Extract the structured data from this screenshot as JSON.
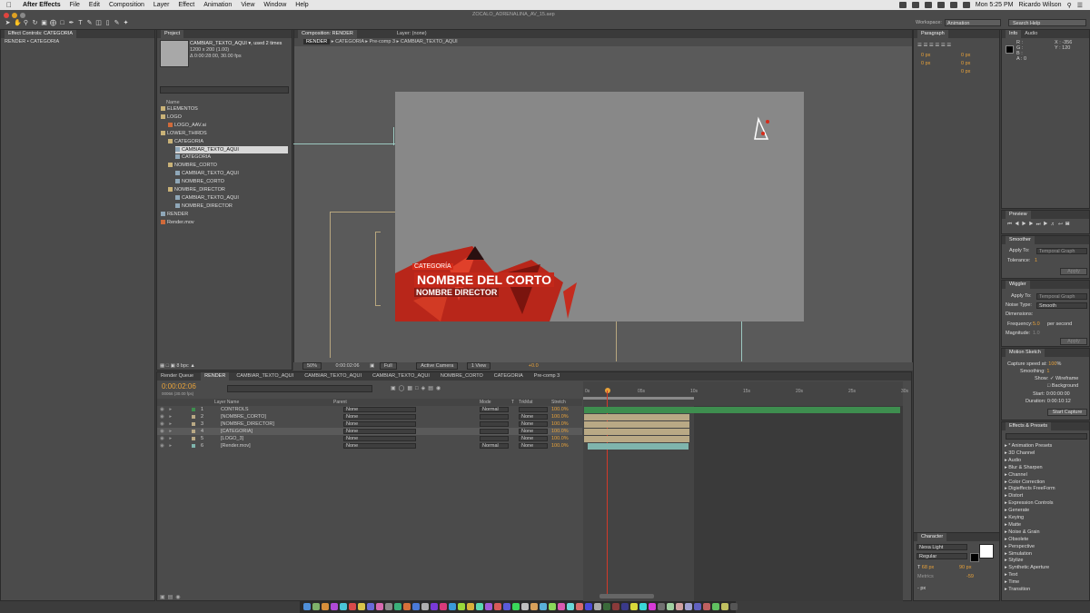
{
  "menubar": {
    "app": "After Effects",
    "items": [
      "File",
      "Edit",
      "Composition",
      "Layer",
      "Effect",
      "Animation",
      "View",
      "Window",
      "Help"
    ],
    "clock": "Mon 5:25 PM",
    "user": "Ricardo Wilson"
  },
  "window": {
    "title": "ZOCALO_ADRENALINA_AV_15.aep"
  },
  "workspace": {
    "label": "Workspace:",
    "value": "Animation",
    "search_placeholder": "Search Help"
  },
  "effect_controls": {
    "tab": "Effect Controls: CATEGORIA",
    "path": "RENDER • CATEGORIA"
  },
  "project": {
    "tab": "Project",
    "selected_name": "CAMBIAR_TEXTO_AQUI",
    "used": ", used 2 times",
    "dims": "1200 x 200 (1.00)",
    "duration": "Δ 0:00:28:00, 30.00 fps",
    "col_name": "Name",
    "bpc": "8 bpc",
    "items": [
      {
        "label": "ELEMENTOS",
        "indent": 0,
        "type": "folder"
      },
      {
        "label": "LOGO",
        "indent": 0,
        "type": "folder"
      },
      {
        "label": "LOGO_AAV.ai",
        "indent": 1,
        "type": "file"
      },
      {
        "label": "LOWER_THIRDS",
        "indent": 0,
        "type": "folder"
      },
      {
        "label": "CATEGORIA",
        "indent": 1,
        "type": "folder"
      },
      {
        "label": "CAMBIAR_TEXTO_AQUI",
        "indent": 2,
        "type": "comp",
        "selected": true
      },
      {
        "label": "CATEGORIA",
        "indent": 2,
        "type": "comp"
      },
      {
        "label": "NOMBRE_CORTO",
        "indent": 1,
        "type": "folder"
      },
      {
        "label": "CAMBIAR_TEXTO_AQUI",
        "indent": 2,
        "type": "comp"
      },
      {
        "label": "NOMBRE_CORTO",
        "indent": 2,
        "type": "comp"
      },
      {
        "label": "NOMBRE_DIRECTOR",
        "indent": 1,
        "type": "folder"
      },
      {
        "label": "CAMBIAR_TEXTO_AQUI",
        "indent": 2,
        "type": "comp"
      },
      {
        "label": "NOMBRE_DIRECTOR",
        "indent": 2,
        "type": "comp"
      },
      {
        "label": "RENDER",
        "indent": 0,
        "type": "comp"
      },
      {
        "label": "Render.mov",
        "indent": 0,
        "type": "file"
      }
    ]
  },
  "composition": {
    "tab": "Composition: RENDER",
    "layer_tab": "Layer: (none)",
    "breadcrumbs": [
      "RENDER",
      "CATEGORIA",
      "Pre-comp 3",
      "CAMBIAR_TEXTO_AQUI"
    ],
    "zoom": "50%",
    "timecode": "0:00:02:06",
    "resolution": "Full",
    "camera": "Active Camera",
    "view": "1 View",
    "exposure": "+0.0",
    "lower_third": {
      "category": "CATEGORÍA",
      "name": "NOMBRE DEL CORTO",
      "director": "NOMBRE DIRECTOR"
    }
  },
  "paragraph": {
    "tab": "Paragraph",
    "fields": [
      "0 px",
      "0 px",
      "0 px",
      "0 px",
      "0 px"
    ]
  },
  "info": {
    "tabs": [
      "Info",
      "Audio"
    ],
    "r": "R :",
    "g": "G :",
    "b": "B :",
    "a": "A : 0",
    "x": "X : -356",
    "y": "Y : 120"
  },
  "preview": {
    "tab": "Preview"
  },
  "smoother": {
    "tab": "Smoother",
    "apply_to_label": "Apply To:",
    "apply_to_value": "Temporal Graph",
    "tolerance_label": "Tolerance:",
    "tolerance_value": "1",
    "apply": "Apply"
  },
  "wiggler": {
    "tab": "Wiggler",
    "apply_to_label": "Apply To:",
    "apply_to_value": "Temporal Graph",
    "noise_label": "Noise Type:",
    "noise_value": "Smooth",
    "dimensions_label": "Dimensions:",
    "frequency_label": "Frequency:",
    "frequency_value": "5.0",
    "frequency_unit": "per second",
    "magnitude_label": "Magnitude:",
    "magnitude_value": "1.0",
    "apply": "Apply"
  },
  "motion_sketch": {
    "tab": "Motion Sketch",
    "capture_label": "Capture speed at:",
    "capture_value": "100",
    "capture_unit": "%",
    "smoothing_label": "Smoothing:",
    "smoothing_value": "1",
    "show_label": "Show:",
    "wireframe": "Wireframe",
    "background": "Background",
    "start_label": "Start:",
    "start_value": "0:00:00:00",
    "duration_label": "Duration:",
    "duration_value": "0:00:10:12",
    "button": "Start Capture"
  },
  "effects_presets": {
    "tab": "Effects & Presets",
    "items": [
      "* Animation Presets",
      "3D Channel",
      "Audio",
      "Blur & Sharpen",
      "Channel",
      "Color Correction",
      "Digieffects FreeForm",
      "Distort",
      "Expression Controls",
      "Generate",
      "Keying",
      "Matte",
      "Noise & Grain",
      "Obsolete",
      "Perspective",
      "Simulation",
      "Stylize",
      "Synthetic Aperture",
      "Text",
      "Time",
      "Transition"
    ]
  },
  "character": {
    "tab": "Character",
    "font": "Nexa Light",
    "style": "Regular",
    "size": "68 px",
    "leading": "90 px",
    "kerning": "Metrics",
    "tracking": "-59",
    "baseline": "- px"
  },
  "timeline": {
    "tabs": [
      "Render Queue",
      "RENDER",
      "CAMBIAR_TEXTO_AQUI",
      "CAMBIAR_TEXTO_AQUI",
      "CAMBIAR_TEXTO_AQUI",
      "NOMBRE_CORTO",
      "CATEGORIA",
      "Pre-comp 3"
    ],
    "timecode": "0:00:02:06",
    "frame": "00066 (30.00 fps)",
    "col_layer": "Layer Name",
    "col_parent": "Parent",
    "col_mode": "Mode",
    "col_t": "T",
    "col_trkmat": "TrkMat",
    "col_stretch": "Stretch",
    "ruler": [
      "0s",
      "05s",
      "10s",
      "15s",
      "20s",
      "25s",
      "30s"
    ],
    "layers": [
      {
        "num": "1",
        "name": "CONTROLS",
        "parent": "None",
        "mode": "Normal",
        "trkmat": "",
        "stretch": "100.0%",
        "color": "#3e8e4f"
      },
      {
        "num": "2",
        "name": "[NOMBRE_CORTO]",
        "parent": "None",
        "mode": "",
        "trkmat": "None",
        "stretch": "100.0%",
        "color": "#b9a985"
      },
      {
        "num": "3",
        "name": "[NOMBRE_DIRECTOR]",
        "parent": "None",
        "mode": "",
        "trkmat": "None",
        "stretch": "100.0%",
        "color": "#b9a985"
      },
      {
        "num": "4",
        "name": "[CATEGORIA]",
        "parent": "None",
        "mode": "",
        "trkmat": "None",
        "stretch": "100.0%",
        "color": "#b9a985",
        "selected": true
      },
      {
        "num": "5",
        "name": "[LOGO_3]",
        "parent": "None",
        "mode": "",
        "trkmat": "None",
        "stretch": "100.0%",
        "color": "#b9a985"
      },
      {
        "num": "6",
        "name": "[Render.mov]",
        "parent": "None",
        "mode": "Normal",
        "trkmat": "None",
        "stretch": "100.0%",
        "color": "#7fb5ad"
      }
    ]
  }
}
